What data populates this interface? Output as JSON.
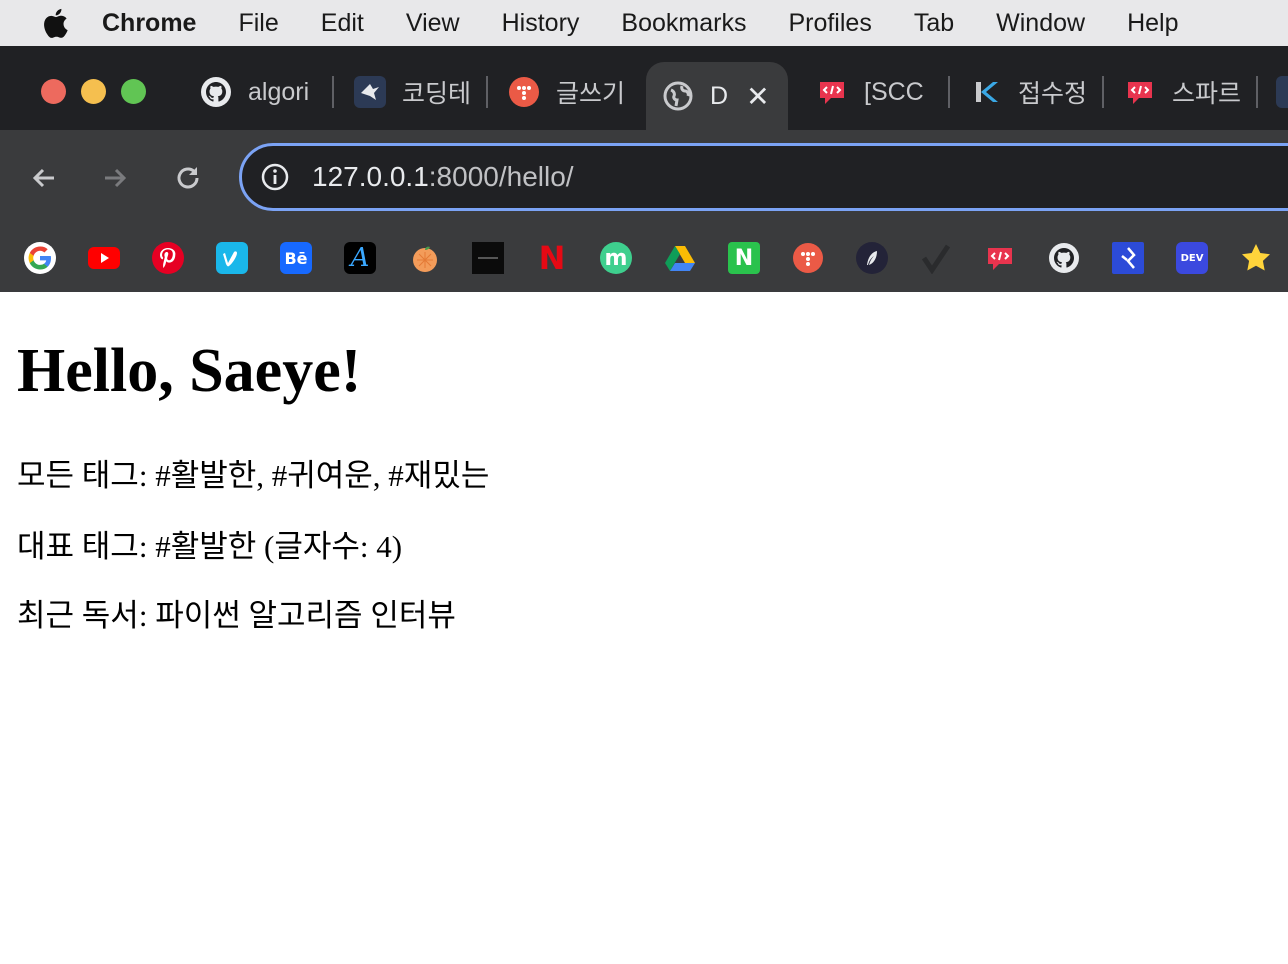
{
  "menubar": {
    "app_name": "Chrome",
    "items": [
      "File",
      "Edit",
      "View",
      "History",
      "Bookmarks",
      "Profiles",
      "Tab",
      "Window",
      "Help"
    ]
  },
  "tabs": [
    {
      "title": "algori",
      "icon": "github-icon"
    },
    {
      "title": "코딩테",
      "icon": "bird-icon"
    },
    {
      "title": "글쓰기",
      "icon": "dots-icon"
    },
    {
      "title": "D",
      "icon": "globe-icon",
      "active": true
    },
    {
      "title": "[SCC",
      "icon": "code-bubble-icon"
    },
    {
      "title": "접수정",
      "icon": "k-icon"
    },
    {
      "title": "스파르",
      "icon": "code-bubble-icon"
    }
  ],
  "toolbar": {
    "url_host": "127.0.0.1",
    "url_rest": ":8000/hello/"
  },
  "bookmarks": [
    "google-icon",
    "youtube-icon",
    "pinterest-icon",
    "vimeo-icon",
    "behance-icon",
    "a-icon",
    "orange-icon",
    "dark-bar-icon",
    "netflix-icon",
    "m-icon",
    "drive-icon",
    "n-icon",
    "dots-icon",
    "feather-icon",
    "check-icon",
    "code-bubble-icon",
    "github-icon",
    "blue-k-icon",
    "dev-icon",
    "star-icon"
  ],
  "bookmark_texts": {
    "behance": "Bē",
    "dev": "DEV",
    "netflix": "N",
    "n": "N",
    "m": "m",
    "a": "A"
  },
  "page": {
    "heading": "Hello, Saeye!",
    "line1": "모든 태그: #활발한, #귀여운, #재밌는",
    "line2": "대표 태그: #활발한 (글자수: 4)",
    "line3": "최근 독서: 파이썬 알고리즘 인터뷰"
  },
  "colors": {
    "omnibox_focus": "#7ba3f5",
    "tab_strip": "#202124",
    "toolbar": "#3a3b3d"
  }
}
